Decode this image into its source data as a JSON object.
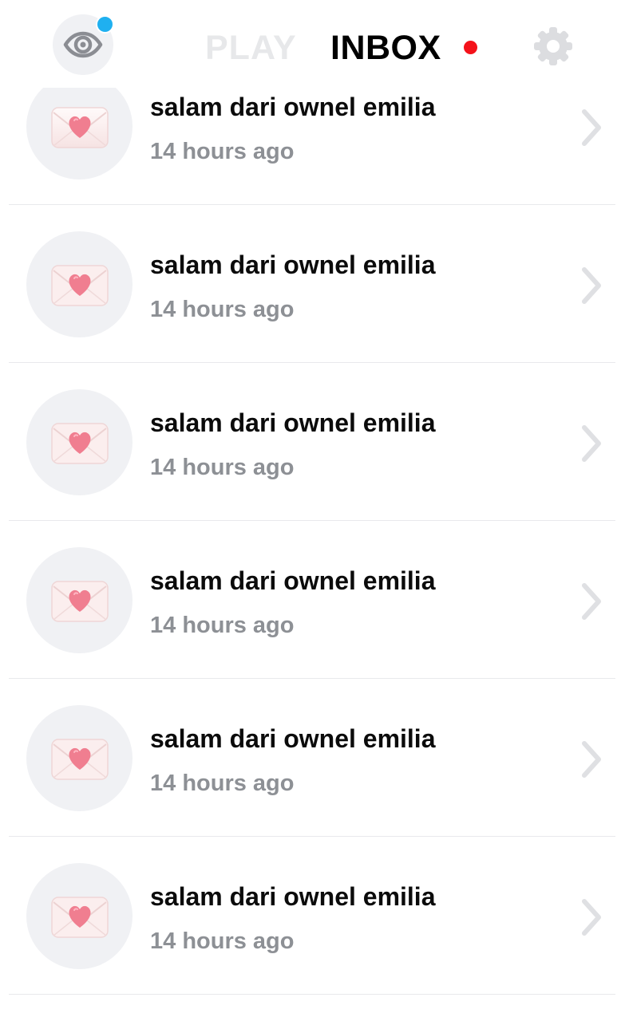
{
  "header": {
    "eye_icon": "eye-icon",
    "notification_dot_color": "#1fb0f0",
    "tabs": [
      {
        "label": "PLAY",
        "active": false
      },
      {
        "label": "INBOX",
        "active": true
      }
    ],
    "inbox_unread_dot_color": "#f4121a",
    "settings_icon": "gear-icon"
  },
  "inbox": {
    "items": [
      {
        "title": "salam dari ownel emilia",
        "time": "14 hours ago",
        "icon": "love-letter-icon"
      },
      {
        "title": "salam dari ownel emilia",
        "time": "14 hours ago",
        "icon": "love-letter-icon"
      },
      {
        "title": "salam dari ownel emilia",
        "time": "14 hours ago",
        "icon": "love-letter-icon"
      },
      {
        "title": "salam dari ownel emilia",
        "time": "14 hours ago",
        "icon": "love-letter-icon"
      },
      {
        "title": "salam dari ownel emilia",
        "time": "14 hours ago",
        "icon": "love-letter-icon"
      },
      {
        "title": "salam dari ownel emilia",
        "time": "14 hours ago",
        "icon": "love-letter-icon"
      }
    ]
  }
}
